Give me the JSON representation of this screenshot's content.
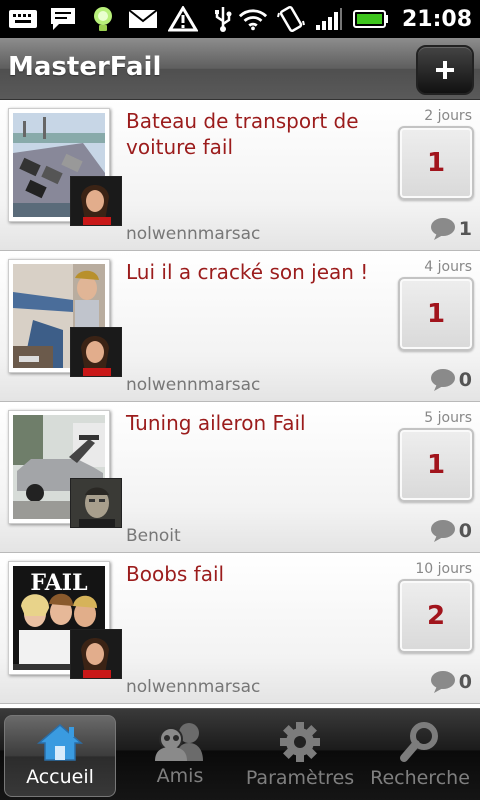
{
  "status_bar": {
    "time": "21:08",
    "icons": [
      "keyboard-icon",
      "message-icon",
      "bulb-icon",
      "mail-icon",
      "warning-icon",
      "usb-icon",
      "wifi-icon",
      "vibrate-icon",
      "signal-icon",
      "battery-icon"
    ]
  },
  "app": {
    "title": "MasterFail",
    "add_label": "+"
  },
  "posts": [
    {
      "title": "Bateau de transport de voiture fail",
      "user": "nolwennmarsac",
      "date": "2 jours",
      "votes": "1",
      "comments": "1"
    },
    {
      "title": "Lui il a cracké son jean !",
      "user": "nolwennmarsac",
      "date": "4 jours",
      "votes": "1",
      "comments": "0"
    },
    {
      "title": "Tuning aileron Fail",
      "user": "Benoit",
      "date": "5 jours",
      "votes": "1",
      "comments": "0"
    },
    {
      "title": "Boobs fail",
      "user": "nolwennmarsac",
      "date": "10 jours",
      "votes": "2",
      "comments": "0",
      "thumb_text": "FAIL"
    }
  ],
  "tabs": [
    {
      "label": "Accueil",
      "icon": "home-icon",
      "active": true
    },
    {
      "label": "Amis",
      "icon": "friends-icon",
      "active": false
    },
    {
      "label": "Paramètres",
      "icon": "gear-icon",
      "active": false
    },
    {
      "label": "Recherche",
      "icon": "search-icon",
      "active": false
    }
  ],
  "colors": {
    "title_red": "#9b1c1c",
    "vote_red": "#a1141c",
    "battery_green": "#3ec51d",
    "home_blue": "#3a9be0"
  }
}
